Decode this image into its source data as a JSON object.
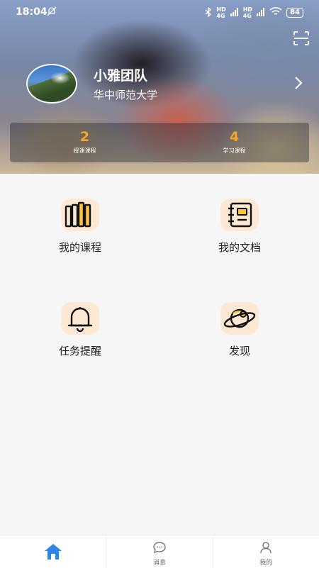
{
  "status_bar": {
    "time": "18:04",
    "signal1": "HD\n4G",
    "signal2": "HD\n4G",
    "battery": "84"
  },
  "profile": {
    "name": "小雅团队",
    "school": "华中师范大学"
  },
  "stats": [
    {
      "value": "2",
      "label": "授课课程"
    },
    {
      "value": "4",
      "label": "学习课程"
    }
  ],
  "menu": [
    {
      "label": "我的课程",
      "icon": "books-icon"
    },
    {
      "label": "我的文档",
      "icon": "notebook-icon"
    },
    {
      "label": "任务提醒",
      "icon": "bell-icon"
    },
    {
      "label": "发现",
      "icon": "planet-icon"
    }
  ],
  "tabs": [
    {
      "label": "",
      "icon": "home-icon",
      "active": true
    },
    {
      "label": "消息",
      "icon": "chat-icon",
      "active": false
    },
    {
      "label": "我的",
      "icon": "user-icon",
      "active": false
    }
  ],
  "colors": {
    "accent": "#f5a623",
    "tab_active": "#2c86e8",
    "icon_bg": "#fde9d3",
    "icon_yellow": "#f6c343"
  }
}
